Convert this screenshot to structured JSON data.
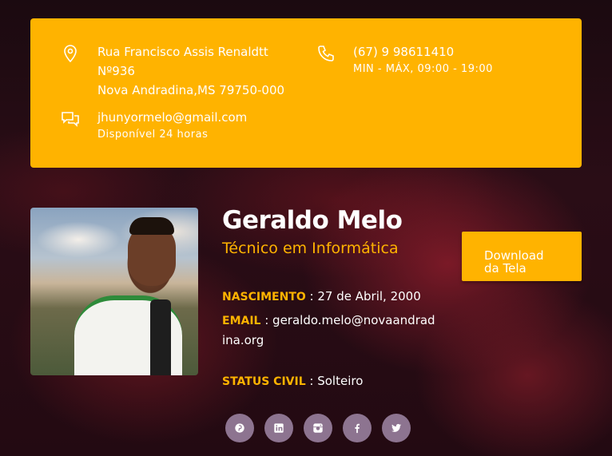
{
  "contact": {
    "address": {
      "line1": "Rua Francisco Assis Renaldtt",
      "line2": "Nº936",
      "line3": "Nova Andradina,MS 79750-000"
    },
    "phone": {
      "number": "(67) 9 98611410",
      "hours": "MIN - MÁX, 09:00 - 19:00"
    },
    "email": {
      "address": "jhunyormelo@gmail.com",
      "availability": "Disponível 24 horas"
    }
  },
  "profile": {
    "name": "Geraldo Melo",
    "role": "Técnico em Informática",
    "download_label": "Download da Tela",
    "birth_label": "NASCIMENTO",
    "birth_value": " : 27 de Abril, 2000",
    "email_label": "EMAIL",
    "email_value": " : geraldo.melo@novaandradina.org",
    "status_label": "STATUS CIVIL",
    "status_value": " : Solteiro"
  },
  "social": [
    "pinterest-icon",
    "linkedin-icon",
    "instagram-icon",
    "facebook-icon",
    "twitter-icon"
  ],
  "colors": {
    "accent": "#ffb300",
    "social_bg": "#8d7490"
  }
}
